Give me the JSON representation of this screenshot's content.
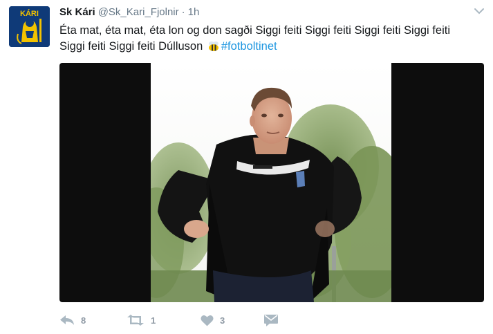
{
  "tweet": {
    "display_name": "Sk Kári",
    "handle": "@Sk_Kari_Fjolnir",
    "separator": "·",
    "time": "1h",
    "text_main": "Éta mat, éta mat, éta lon og don sagði Siggi feiti Siggi feiti Siggi feiti Siggi feiti Siggi feiti Siggi feiti Dúlluson",
    "hashtag": "#fotboltinet",
    "avatar_text": "KÁRI"
  },
  "actions": {
    "reply_count": "8",
    "retweet_count": "1",
    "like_count": "3"
  },
  "icons": {
    "reply": "reply-icon",
    "retweet": "retweet-icon",
    "like": "heart-icon",
    "message": "envelope-icon",
    "menu": "chevron-down-icon",
    "emoji": "bee-emoji"
  },
  "colors": {
    "hashtag": "#1b95e0",
    "muted": "#657786",
    "action_icon": "#aab8c2",
    "avatar_bg": "#0f3a78",
    "avatar_accent": "#f2c200"
  }
}
